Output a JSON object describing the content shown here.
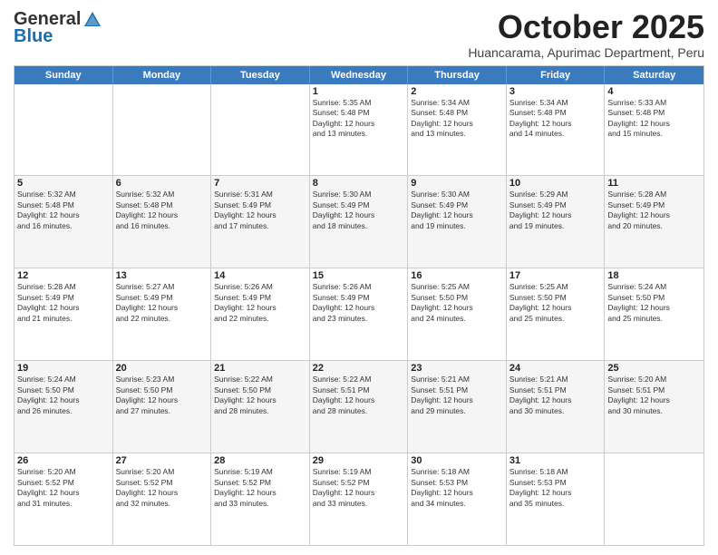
{
  "logo": {
    "general": "General",
    "blue": "Blue"
  },
  "header": {
    "month": "October 2025",
    "subtitle": "Huancarama, Apurimac Department, Peru"
  },
  "weekdays": [
    "Sunday",
    "Monday",
    "Tuesday",
    "Wednesday",
    "Thursday",
    "Friday",
    "Saturday"
  ],
  "rows": [
    [
      {
        "day": "",
        "text": ""
      },
      {
        "day": "",
        "text": ""
      },
      {
        "day": "",
        "text": ""
      },
      {
        "day": "1",
        "text": "Sunrise: 5:35 AM\nSunset: 5:48 PM\nDaylight: 12 hours\nand 13 minutes."
      },
      {
        "day": "2",
        "text": "Sunrise: 5:34 AM\nSunset: 5:48 PM\nDaylight: 12 hours\nand 13 minutes."
      },
      {
        "day": "3",
        "text": "Sunrise: 5:34 AM\nSunset: 5:48 PM\nDaylight: 12 hours\nand 14 minutes."
      },
      {
        "day": "4",
        "text": "Sunrise: 5:33 AM\nSunset: 5:48 PM\nDaylight: 12 hours\nand 15 minutes."
      }
    ],
    [
      {
        "day": "5",
        "text": "Sunrise: 5:32 AM\nSunset: 5:48 PM\nDaylight: 12 hours\nand 16 minutes."
      },
      {
        "day": "6",
        "text": "Sunrise: 5:32 AM\nSunset: 5:48 PM\nDaylight: 12 hours\nand 16 minutes."
      },
      {
        "day": "7",
        "text": "Sunrise: 5:31 AM\nSunset: 5:49 PM\nDaylight: 12 hours\nand 17 minutes."
      },
      {
        "day": "8",
        "text": "Sunrise: 5:30 AM\nSunset: 5:49 PM\nDaylight: 12 hours\nand 18 minutes."
      },
      {
        "day": "9",
        "text": "Sunrise: 5:30 AM\nSunset: 5:49 PM\nDaylight: 12 hours\nand 19 minutes."
      },
      {
        "day": "10",
        "text": "Sunrise: 5:29 AM\nSunset: 5:49 PM\nDaylight: 12 hours\nand 19 minutes."
      },
      {
        "day": "11",
        "text": "Sunrise: 5:28 AM\nSunset: 5:49 PM\nDaylight: 12 hours\nand 20 minutes."
      }
    ],
    [
      {
        "day": "12",
        "text": "Sunrise: 5:28 AM\nSunset: 5:49 PM\nDaylight: 12 hours\nand 21 minutes."
      },
      {
        "day": "13",
        "text": "Sunrise: 5:27 AM\nSunset: 5:49 PM\nDaylight: 12 hours\nand 22 minutes."
      },
      {
        "day": "14",
        "text": "Sunrise: 5:26 AM\nSunset: 5:49 PM\nDaylight: 12 hours\nand 22 minutes."
      },
      {
        "day": "15",
        "text": "Sunrise: 5:26 AM\nSunset: 5:49 PM\nDaylight: 12 hours\nand 23 minutes."
      },
      {
        "day": "16",
        "text": "Sunrise: 5:25 AM\nSunset: 5:50 PM\nDaylight: 12 hours\nand 24 minutes."
      },
      {
        "day": "17",
        "text": "Sunrise: 5:25 AM\nSunset: 5:50 PM\nDaylight: 12 hours\nand 25 minutes."
      },
      {
        "day": "18",
        "text": "Sunrise: 5:24 AM\nSunset: 5:50 PM\nDaylight: 12 hours\nand 25 minutes."
      }
    ],
    [
      {
        "day": "19",
        "text": "Sunrise: 5:24 AM\nSunset: 5:50 PM\nDaylight: 12 hours\nand 26 minutes."
      },
      {
        "day": "20",
        "text": "Sunrise: 5:23 AM\nSunset: 5:50 PM\nDaylight: 12 hours\nand 27 minutes."
      },
      {
        "day": "21",
        "text": "Sunrise: 5:22 AM\nSunset: 5:50 PM\nDaylight: 12 hours\nand 28 minutes."
      },
      {
        "day": "22",
        "text": "Sunrise: 5:22 AM\nSunset: 5:51 PM\nDaylight: 12 hours\nand 28 minutes."
      },
      {
        "day": "23",
        "text": "Sunrise: 5:21 AM\nSunset: 5:51 PM\nDaylight: 12 hours\nand 29 minutes."
      },
      {
        "day": "24",
        "text": "Sunrise: 5:21 AM\nSunset: 5:51 PM\nDaylight: 12 hours\nand 30 minutes."
      },
      {
        "day": "25",
        "text": "Sunrise: 5:20 AM\nSunset: 5:51 PM\nDaylight: 12 hours\nand 30 minutes."
      }
    ],
    [
      {
        "day": "26",
        "text": "Sunrise: 5:20 AM\nSunset: 5:52 PM\nDaylight: 12 hours\nand 31 minutes."
      },
      {
        "day": "27",
        "text": "Sunrise: 5:20 AM\nSunset: 5:52 PM\nDaylight: 12 hours\nand 32 minutes."
      },
      {
        "day": "28",
        "text": "Sunrise: 5:19 AM\nSunset: 5:52 PM\nDaylight: 12 hours\nand 33 minutes."
      },
      {
        "day": "29",
        "text": "Sunrise: 5:19 AM\nSunset: 5:52 PM\nDaylight: 12 hours\nand 33 minutes."
      },
      {
        "day": "30",
        "text": "Sunrise: 5:18 AM\nSunset: 5:53 PM\nDaylight: 12 hours\nand 34 minutes."
      },
      {
        "day": "31",
        "text": "Sunrise: 5:18 AM\nSunset: 5:53 PM\nDaylight: 12 hours\nand 35 minutes."
      },
      {
        "day": "",
        "text": ""
      }
    ]
  ]
}
